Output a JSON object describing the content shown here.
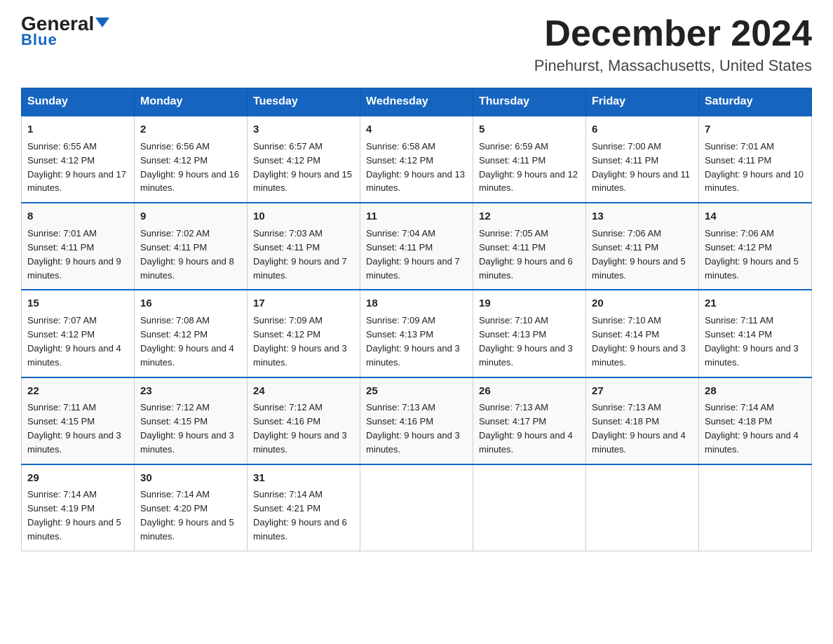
{
  "header": {
    "logo_general": "General",
    "logo_blue": "Blue",
    "title": "December 2024",
    "subtitle": "Pinehurst, Massachusetts, United States"
  },
  "days_of_week": [
    "Sunday",
    "Monday",
    "Tuesday",
    "Wednesday",
    "Thursday",
    "Friday",
    "Saturday"
  ],
  "weeks": [
    [
      {
        "day": "1",
        "sunrise": "6:55 AM",
        "sunset": "4:12 PM",
        "daylight": "9 hours and 17 minutes."
      },
      {
        "day": "2",
        "sunrise": "6:56 AM",
        "sunset": "4:12 PM",
        "daylight": "9 hours and 16 minutes."
      },
      {
        "day": "3",
        "sunrise": "6:57 AM",
        "sunset": "4:12 PM",
        "daylight": "9 hours and 15 minutes."
      },
      {
        "day": "4",
        "sunrise": "6:58 AM",
        "sunset": "4:12 PM",
        "daylight": "9 hours and 13 minutes."
      },
      {
        "day": "5",
        "sunrise": "6:59 AM",
        "sunset": "4:11 PM",
        "daylight": "9 hours and 12 minutes."
      },
      {
        "day": "6",
        "sunrise": "7:00 AM",
        "sunset": "4:11 PM",
        "daylight": "9 hours and 11 minutes."
      },
      {
        "day": "7",
        "sunrise": "7:01 AM",
        "sunset": "4:11 PM",
        "daylight": "9 hours and 10 minutes."
      }
    ],
    [
      {
        "day": "8",
        "sunrise": "7:01 AM",
        "sunset": "4:11 PM",
        "daylight": "9 hours and 9 minutes."
      },
      {
        "day": "9",
        "sunrise": "7:02 AM",
        "sunset": "4:11 PM",
        "daylight": "9 hours and 8 minutes."
      },
      {
        "day": "10",
        "sunrise": "7:03 AM",
        "sunset": "4:11 PM",
        "daylight": "9 hours and 7 minutes."
      },
      {
        "day": "11",
        "sunrise": "7:04 AM",
        "sunset": "4:11 PM",
        "daylight": "9 hours and 7 minutes."
      },
      {
        "day": "12",
        "sunrise": "7:05 AM",
        "sunset": "4:11 PM",
        "daylight": "9 hours and 6 minutes."
      },
      {
        "day": "13",
        "sunrise": "7:06 AM",
        "sunset": "4:11 PM",
        "daylight": "9 hours and 5 minutes."
      },
      {
        "day": "14",
        "sunrise": "7:06 AM",
        "sunset": "4:12 PM",
        "daylight": "9 hours and 5 minutes."
      }
    ],
    [
      {
        "day": "15",
        "sunrise": "7:07 AM",
        "sunset": "4:12 PM",
        "daylight": "9 hours and 4 minutes."
      },
      {
        "day": "16",
        "sunrise": "7:08 AM",
        "sunset": "4:12 PM",
        "daylight": "9 hours and 4 minutes."
      },
      {
        "day": "17",
        "sunrise": "7:09 AM",
        "sunset": "4:12 PM",
        "daylight": "9 hours and 3 minutes."
      },
      {
        "day": "18",
        "sunrise": "7:09 AM",
        "sunset": "4:13 PM",
        "daylight": "9 hours and 3 minutes."
      },
      {
        "day": "19",
        "sunrise": "7:10 AM",
        "sunset": "4:13 PM",
        "daylight": "9 hours and 3 minutes."
      },
      {
        "day": "20",
        "sunrise": "7:10 AM",
        "sunset": "4:14 PM",
        "daylight": "9 hours and 3 minutes."
      },
      {
        "day": "21",
        "sunrise": "7:11 AM",
        "sunset": "4:14 PM",
        "daylight": "9 hours and 3 minutes."
      }
    ],
    [
      {
        "day": "22",
        "sunrise": "7:11 AM",
        "sunset": "4:15 PM",
        "daylight": "9 hours and 3 minutes."
      },
      {
        "day": "23",
        "sunrise": "7:12 AM",
        "sunset": "4:15 PM",
        "daylight": "9 hours and 3 minutes."
      },
      {
        "day": "24",
        "sunrise": "7:12 AM",
        "sunset": "4:16 PM",
        "daylight": "9 hours and 3 minutes."
      },
      {
        "day": "25",
        "sunrise": "7:13 AM",
        "sunset": "4:16 PM",
        "daylight": "9 hours and 3 minutes."
      },
      {
        "day": "26",
        "sunrise": "7:13 AM",
        "sunset": "4:17 PM",
        "daylight": "9 hours and 4 minutes."
      },
      {
        "day": "27",
        "sunrise": "7:13 AM",
        "sunset": "4:18 PM",
        "daylight": "9 hours and 4 minutes."
      },
      {
        "day": "28",
        "sunrise": "7:14 AM",
        "sunset": "4:18 PM",
        "daylight": "9 hours and 4 minutes."
      }
    ],
    [
      {
        "day": "29",
        "sunrise": "7:14 AM",
        "sunset": "4:19 PM",
        "daylight": "9 hours and 5 minutes."
      },
      {
        "day": "30",
        "sunrise": "7:14 AM",
        "sunset": "4:20 PM",
        "daylight": "9 hours and 5 minutes."
      },
      {
        "day": "31",
        "sunrise": "7:14 AM",
        "sunset": "4:21 PM",
        "daylight": "9 hours and 6 minutes."
      },
      null,
      null,
      null,
      null
    ]
  ]
}
